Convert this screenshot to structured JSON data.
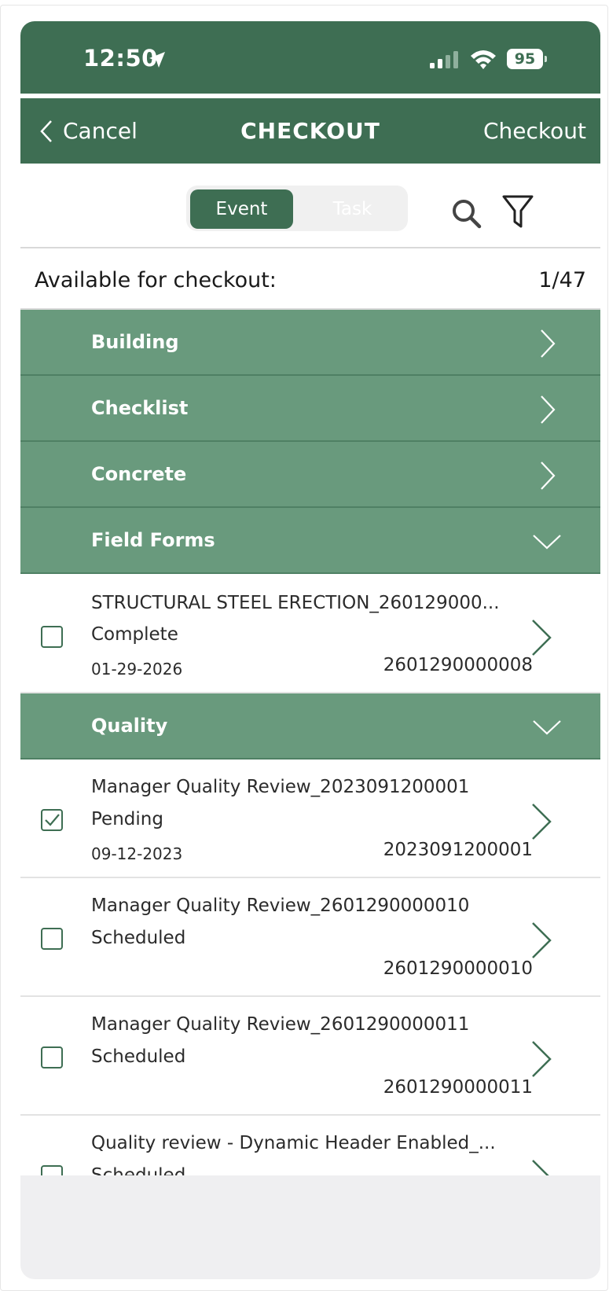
{
  "status_bar": {
    "time": "12:50",
    "battery": "95",
    "location_icon": "location-arrow-icon",
    "signal_icon": "cellular-signal-icon",
    "wifi_icon": "wifi-icon",
    "battery_icon": "battery-icon"
  },
  "nav": {
    "back_label": "Cancel",
    "title": "CHECKOUT",
    "action_label": "Checkout"
  },
  "segment": {
    "options": [
      "Event",
      "Task"
    ],
    "selected": "Event"
  },
  "toolbar": {
    "search_icon": "search-icon",
    "filter_icon": "filter-icon"
  },
  "available": {
    "label": "Available for checkout:",
    "count": "1/47"
  },
  "categories": [
    {
      "label": "Building",
      "expanded": false
    },
    {
      "label": "Checklist",
      "expanded": false
    },
    {
      "label": "Concrete",
      "expanded": false
    },
    {
      "label": "Field Forms",
      "expanded": true
    },
    {
      "label": "Quality",
      "expanded": true
    }
  ],
  "field_forms_items": [
    {
      "title": "STRUCTURAL STEEL ERECTION_260129000...",
      "status": "Complete",
      "date": "01-29-2026",
      "number": "2601290000008",
      "checked": false
    }
  ],
  "quality_items": [
    {
      "title": "Manager Quality Review_2023091200001",
      "status": "Pending",
      "date": "09-12-2023",
      "number": "2023091200001",
      "checked": true
    },
    {
      "title": "Manager Quality Review_2601290000010",
      "status": "Scheduled",
      "date": "",
      "number": "2601290000010",
      "checked": false
    },
    {
      "title": "Manager Quality Review_2601290000011",
      "status": "Scheduled",
      "date": "",
      "number": "2601290000011",
      "checked": false
    },
    {
      "title": "Quality review - Dynamic Header Enabled_...",
      "status": "Scheduled",
      "date": "",
      "number": "",
      "checked": false
    }
  ],
  "colors": {
    "primary": "#3e6e53",
    "category_bg": "#699a7d",
    "bottom_bar": "#efeff1"
  }
}
